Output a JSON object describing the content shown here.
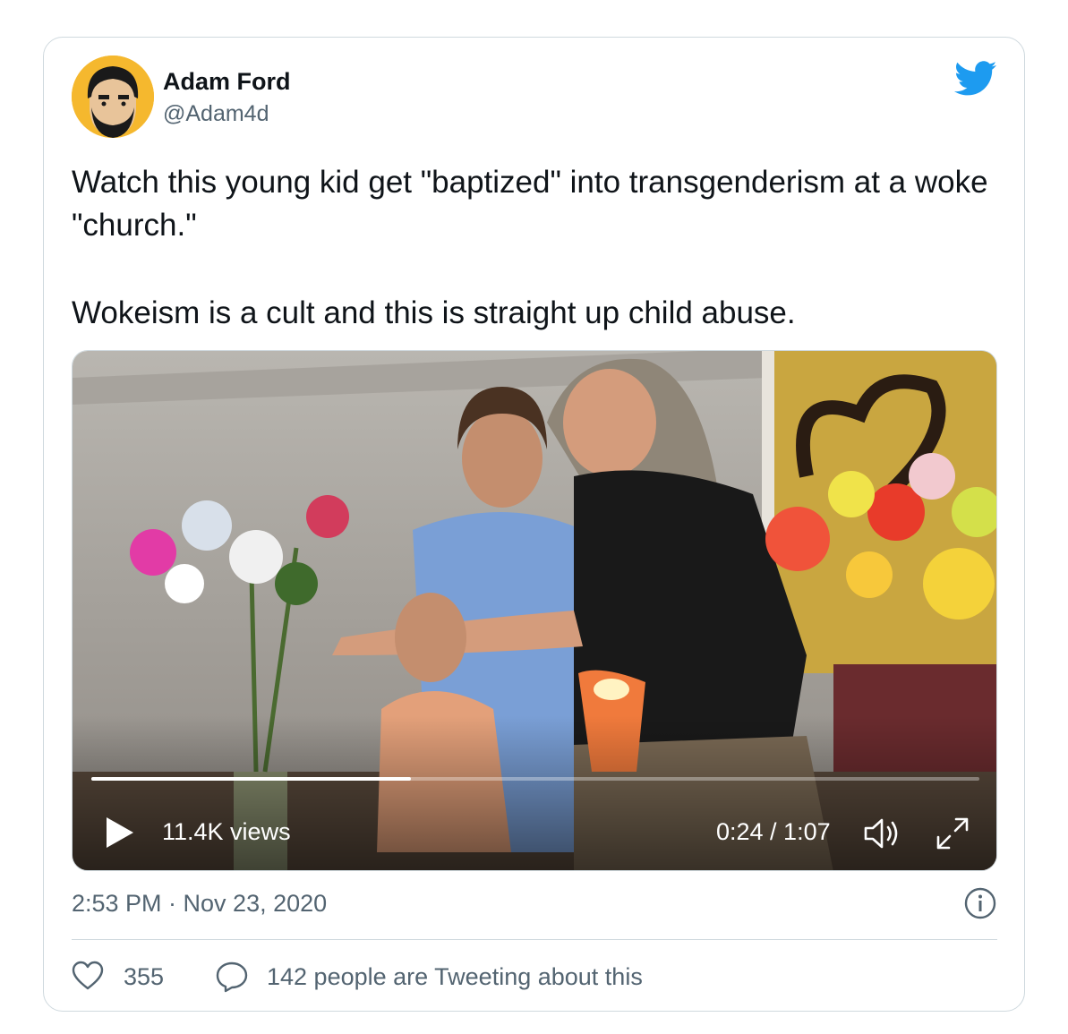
{
  "author": {
    "name": "Adam Ford",
    "handle": "@Adam4d"
  },
  "tweet": {
    "paragraph1": "Watch this young kid get \"baptized\" into transgenderism at a woke \"church.\"",
    "paragraph2": "Wokeism is a cult and this is straight up child abuse."
  },
  "video": {
    "views": "11.4K views",
    "time": "0:24 / 1:07",
    "progress": 0.36
  },
  "meta": {
    "timestamp": "2:53 PM · Nov 23, 2020"
  },
  "actions": {
    "likes": "355",
    "tweeting": "142 people are Tweeting about this"
  },
  "icons": [
    "twitter-bird-icon",
    "play-icon",
    "volume-icon",
    "expand-icon",
    "info-icon",
    "heart-icon",
    "reply-bubble-icon"
  ],
  "colors": {
    "brand": "#1d9bf0",
    "secondary_text": "#536471",
    "avatar_bg": "#f5b82e"
  }
}
